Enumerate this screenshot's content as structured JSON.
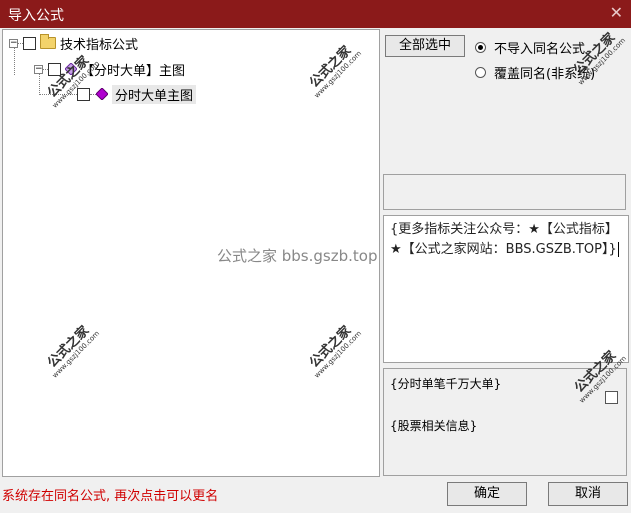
{
  "window": {
    "title": "导入公式",
    "close_glyph": "✕"
  },
  "tree": {
    "root_label": "技术指标公式",
    "group_label": "【分时大单】主图",
    "item_label": "分时大单主图",
    "expander_glyph": "−"
  },
  "actions": {
    "select_all": "全部选中",
    "confirm": "确定",
    "cancel": "取消"
  },
  "options": {
    "skip_same_name": "不导入同名公式",
    "overwrite_same_name": "覆盖同名(非系统)"
  },
  "note": {
    "text": "{更多指标关注公众号：★【公式指标】★【公式之家网站：BBS.GSZB.TOP】}"
  },
  "info": {
    "line1": "{分时单笔千万大单}",
    "line2": "{股票相关信息}"
  },
  "status": {
    "message": "系统存在同名公式, 再次点击可以更名"
  },
  "watermark": {
    "center_text": "公式之家 bbs.gszb.top",
    "stamp_text": "公式之家",
    "stamp_url": "www.gszj100.com"
  },
  "colors": {
    "titlebar": "#8b1a1a",
    "status_text": "#d00000",
    "accent_diamond": "#8a2be2"
  }
}
